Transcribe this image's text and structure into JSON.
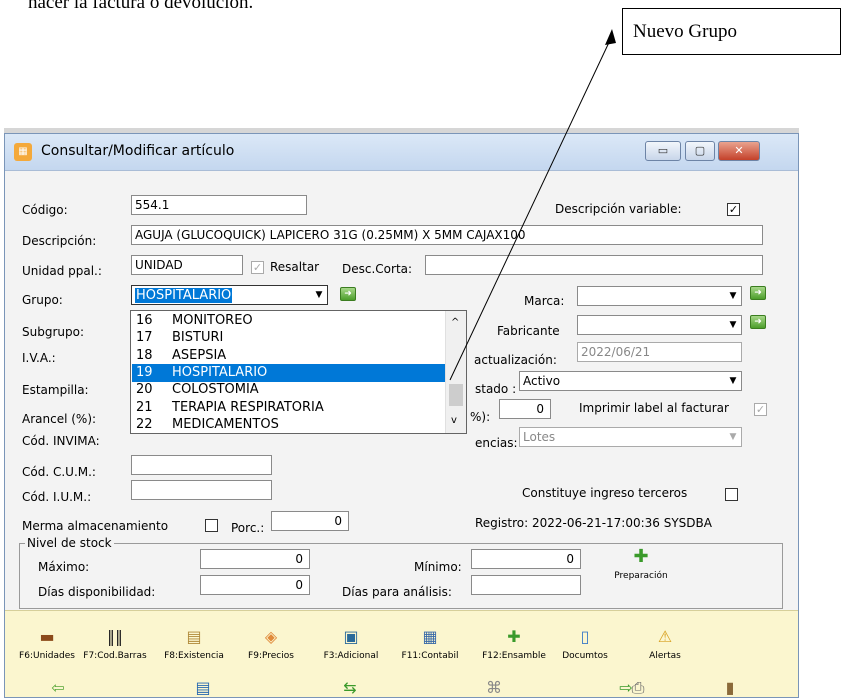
{
  "doc": {
    "top_text": "hacer la factura o devolución.",
    "callout": "Nuevo Grupo"
  },
  "window": {
    "title": "Consultar/Modificar artículo",
    "controls": {
      "minimize": "▭",
      "maximize": "▢",
      "close": "✕"
    }
  },
  "form": {
    "codigo_label": "Código:",
    "codigo_value": "554.1",
    "desc_variable_label": "Descripción variable:",
    "desc_variable_checked": "✓",
    "descripcion_label": "Descripción:",
    "descripcion_value": "AGUJA (GLUCOQUICK) LAPICERO 31G (0.25MM) X 5MM  CAJAX100",
    "unidad_label": "Unidad ppal.:",
    "unidad_value": "UNIDAD",
    "resaltar_label": "Resaltar",
    "resaltar_checked": "✓",
    "desc_corta_label": "Desc.Corta:",
    "desc_corta_value": "",
    "grupo_label": "Grupo:",
    "grupo_value": "HOSPITALARIO",
    "marca_label": "Marca:",
    "marca_value": "",
    "subgrupo_label": "Subgrupo:",
    "fabricante_label": "Fabricante",
    "fabricante_value": "",
    "iva_label": "I.V.A.:",
    "actualizacion_label": "actualización:",
    "actualizacion_value": "2022/06/21",
    "estampilla_label": "Estampilla:",
    "estado_label": "stado :",
    "estado_value": "Activo",
    "arancel_label": "Arancel (%):",
    "pct_label": "%):",
    "pct_value": "0",
    "imprimir_label": "Imprimir label al facturar",
    "imprimir_checked": "✓",
    "invima_label": "Cód. INVIMA:",
    "existencias_label": "encias:",
    "existencias_value": "Lotes",
    "cum_label": "Cód. C.U.M.:",
    "cum_value": "",
    "ium_label": "Cód. I.U.M.:",
    "ium_value": "",
    "terceros_label": "Constituye ingreso terceros",
    "merma_label": "Merma almacenamiento",
    "porc_label": "Porc.:",
    "porc_value": "0",
    "registro": "Registro: 2022-06-21-17:00:36 SYSDBA"
  },
  "dropdown": {
    "items": [
      {
        "code": "16",
        "name": "MONITOREO"
      },
      {
        "code": "17",
        "name": "BISTURI"
      },
      {
        "code": "18",
        "name": "ASEPSIA"
      },
      {
        "code": "19",
        "name": "HOSPITALARIO"
      },
      {
        "code": "20",
        "name": "COLOSTOMIA"
      },
      {
        "code": "21",
        "name": "TERAPIA RESPIRATORIA"
      },
      {
        "code": "22",
        "name": "MEDICAMENTOS"
      }
    ],
    "selected_index": 3
  },
  "stock": {
    "legend": "Nivel de stock",
    "maximo_label": "Máximo:",
    "maximo_value": "0",
    "minimo_label": "Mínimo:",
    "minimo_value": "0",
    "disponibilidad_label": "Días disponibilidad:",
    "disponibilidad_value": "0",
    "analisis_label": "Días para análisis:",
    "analisis_value": "",
    "preparacion_label": "Preparación"
  },
  "toolbar": {
    "items": [
      {
        "label": "F6:Unidades",
        "icon": "box-icon"
      },
      {
        "label": "F7:Cod.Barras",
        "icon": "barcode-icon"
      },
      {
        "label": "F8:Existencia",
        "icon": "clipboard-icon"
      },
      {
        "label": "F9:Precios",
        "icon": "tag-icon"
      },
      {
        "label": "F3:Adicional",
        "icon": "form-icon"
      },
      {
        "label": "F11:Contabil",
        "icon": "ledger-icon"
      },
      {
        "label": "F12:Ensamble",
        "icon": "puzzle-icon"
      },
      {
        "label": "Documtos",
        "icon": "document-icon"
      },
      {
        "label": "Alertas",
        "icon": "warning-icon"
      }
    ],
    "row2_icons": [
      "back-arrow-icon",
      "save-icon",
      "transfer-icon",
      "network-icon",
      "print-icon",
      "forward-arrow-icon",
      "exit-door-icon"
    ]
  },
  "colors": {
    "selection": "#0078d7",
    "toolbar_bg": "#fbf6cf",
    "titlebar": "#c4d7ef"
  }
}
